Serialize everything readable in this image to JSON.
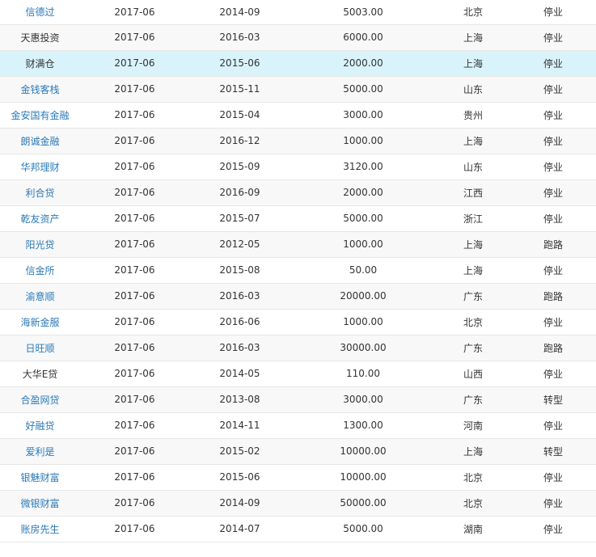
{
  "table": {
    "rows": [
      {
        "name": "信德过",
        "date1": "2017-06",
        "date2": "2014-09",
        "amount": "5003.00",
        "region": "北京",
        "status": "停业",
        "link": true
      },
      {
        "name": "天惠投资",
        "date1": "2017-06",
        "date2": "2016-03",
        "amount": "6000.00",
        "region": "上海",
        "status": "停业",
        "link": false
      },
      {
        "name": "财满仓",
        "date1": "2017-06",
        "date2": "2015-06",
        "amount": "2000.00",
        "region": "上海",
        "status": "停业",
        "link": false
      },
      {
        "name": "金钱客栈",
        "date1": "2017-06",
        "date2": "2015-11",
        "amount": "5000.00",
        "region": "山东",
        "status": "停业",
        "link": true
      },
      {
        "name": "金安国有金融",
        "date1": "2017-06",
        "date2": "2015-04",
        "amount": "3000.00",
        "region": "贵州",
        "status": "停业",
        "link": true
      },
      {
        "name": "朗诚金融",
        "date1": "2017-06",
        "date2": "2016-12",
        "amount": "1000.00",
        "region": "上海",
        "status": "停业",
        "link": true
      },
      {
        "name": "华邦理财",
        "date1": "2017-06",
        "date2": "2015-09",
        "amount": "3120.00",
        "region": "山东",
        "status": "停业",
        "link": true
      },
      {
        "name": "利合贷",
        "date1": "2017-06",
        "date2": "2016-09",
        "amount": "2000.00",
        "region": "江西",
        "status": "停业",
        "link": true
      },
      {
        "name": "乾友资产",
        "date1": "2017-06",
        "date2": "2015-07",
        "amount": "5000.00",
        "region": "浙江",
        "status": "停业",
        "link": true
      },
      {
        "name": "阳光贷",
        "date1": "2017-06",
        "date2": "2012-05",
        "amount": "1000.00",
        "region": "上海",
        "status": "跑路",
        "link": true
      },
      {
        "name": "信金所",
        "date1": "2017-06",
        "date2": "2015-08",
        "amount": "50.00",
        "region": "上海",
        "status": "停业",
        "link": true
      },
      {
        "name": "渝意顺",
        "date1": "2017-06",
        "date2": "2016-03",
        "amount": "20000.00",
        "region": "广东",
        "status": "跑路",
        "link": true
      },
      {
        "name": "海新金服",
        "date1": "2017-06",
        "date2": "2016-06",
        "amount": "1000.00",
        "region": "北京",
        "status": "停业",
        "link": true
      },
      {
        "name": "日旺顺",
        "date1": "2017-06",
        "date2": "2016-03",
        "amount": "30000.00",
        "region": "广东",
        "status": "跑路",
        "link": true
      },
      {
        "name": "大华E贷",
        "date1": "2017-06",
        "date2": "2014-05",
        "amount": "110.00",
        "region": "山西",
        "status": "停业",
        "link": false
      },
      {
        "name": "合盈网贷",
        "date1": "2017-06",
        "date2": "2013-08",
        "amount": "3000.00",
        "region": "广东",
        "status": "转型",
        "link": true
      },
      {
        "name": "好融贷",
        "date1": "2017-06",
        "date2": "2014-11",
        "amount": "1300.00",
        "region": "河南",
        "status": "停业",
        "link": true
      },
      {
        "name": "爱利是",
        "date1": "2017-06",
        "date2": "2015-02",
        "amount": "10000.00",
        "region": "上海",
        "status": "转型",
        "link": true
      },
      {
        "name": "银魅财富",
        "date1": "2017-06",
        "date2": "2015-06",
        "amount": "10000.00",
        "region": "北京",
        "status": "停业",
        "link": true
      },
      {
        "name": "微银财富",
        "date1": "2017-06",
        "date2": "2014-09",
        "amount": "50000.00",
        "region": "北京",
        "status": "停业",
        "link": true
      },
      {
        "name": "账房先生",
        "date1": "2017-06",
        "date2": "2014-07",
        "amount": "5000.00",
        "region": "湖南",
        "status": "停业",
        "link": true
      }
    ]
  }
}
